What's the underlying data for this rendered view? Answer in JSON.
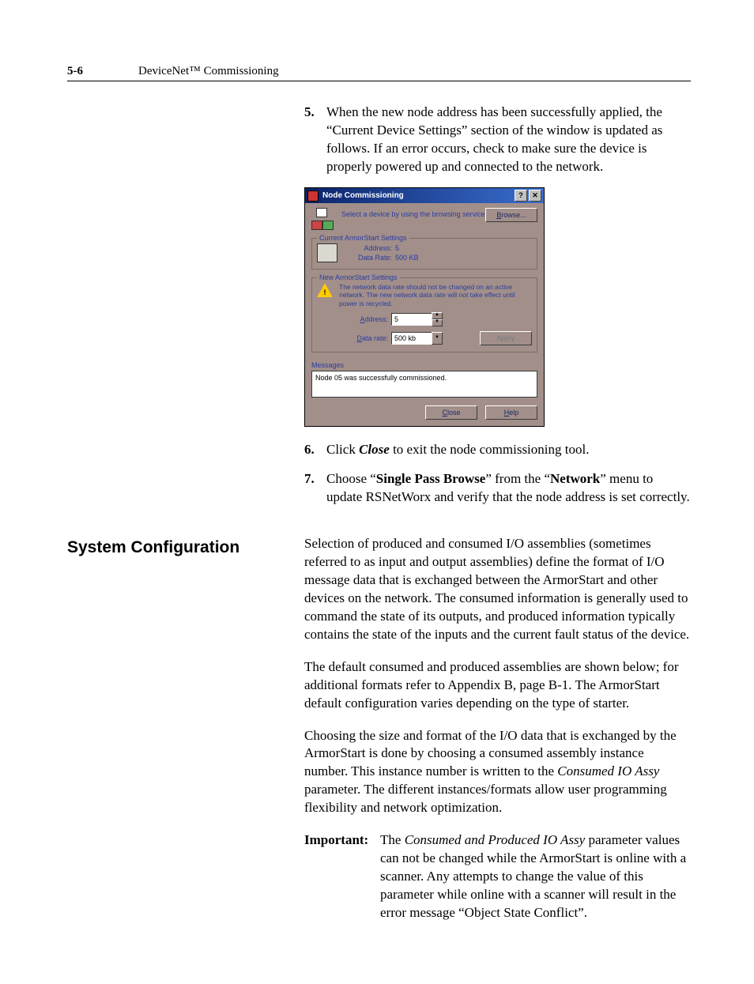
{
  "header": {
    "pagenum": "5-6",
    "title": "DeviceNet™ Commissioning"
  },
  "steps": {
    "s5": {
      "num": "5.",
      "text": "When the new node address has been successfully applied, the “Current Device Settings” section of the window is updated as follows. If an error occurs, check to make sure the device is properly powered up and connected to the network."
    },
    "s6": {
      "num": "6.",
      "pre": "Click ",
      "em": "Close",
      "post": " to exit the node commissioning tool."
    },
    "s7": {
      "num": "7.",
      "a": "Choose “",
      "b": "Single Pass Browse",
      "c": "” from the “",
      "d": "Network",
      "e": "” menu to update RSNetWorx and verify that the node address is set correctly."
    }
  },
  "section_heading": "System Configuration",
  "paras": {
    "p1": "Selection of produced and consumed I/O assemblies (sometimes referred to as input and output assemblies) define the format of I/O message data that is exchanged between the ArmorStart and other devices on the network. The consumed information is generally used to command the state of its outputs, and produced information typically contains the state of the inputs and the current fault status of the device.",
    "p2": "The default consumed and produced assemblies are shown below; for additional formats refer to Appendix B, page B-1. The ArmorStart default configuration varies depending on the type of starter.",
    "p3a": "Choosing the size and format of the I/O data that is exchanged by the ArmorStart is done by choosing a consumed assembly instance number. This instance number is written to the ",
    "p3b": "Consumed IO Assy",
    "p3c": " parameter. The different instances/formats allow user programming flexibility and network optimization.",
    "imp_label": "Important:",
    "imp_a": "The ",
    "imp_b": "Consumed and Produced IO Assy",
    "imp_c": " parameter values can not be changed while the ArmorStart is online with a scanner. Any attempts to change the value of this parameter while online with a scanner will result in the error message “Object State Conflict”."
  },
  "dlg": {
    "title": "Node Commissioning",
    "help_btn": "?",
    "close_btn": "✕",
    "instruct": "Select a device by using the browsing service",
    "browse": "Browse...",
    "grp_current": "Current ArmorStart Settings",
    "addr_label": "Address:",
    "addr_value": "5",
    "rate_label": "Data Rate:",
    "rate_value": "500 KB",
    "grp_new": "New ArmorStart Settings",
    "warn": "The network data rate should not be changed on an active network. The new network data rate will not take effect until power is recycled.",
    "new_addr_label": "Address:",
    "new_addr_value": "5",
    "new_rate_label": "Data rate:",
    "new_rate_value": "500 kb",
    "apply": "Apply",
    "messages_label": "Messages",
    "messages_text": "Node 05 was successfully commissioned.",
    "closebtn": "Close",
    "helpbtn": "Help"
  }
}
